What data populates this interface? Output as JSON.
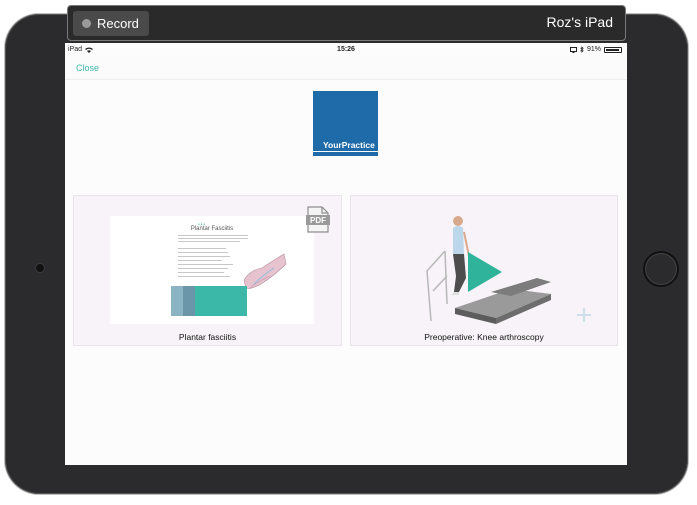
{
  "recorder": {
    "record_label": "Record",
    "device_name": "Roz's iPad"
  },
  "status_bar": {
    "device": "iPad",
    "time": "15:26",
    "battery": "91%"
  },
  "nav": {
    "close_label": "Close"
  },
  "logo": {
    "text": "YourPractice",
    "color": "#1f6aa8"
  },
  "cards": [
    {
      "title": "Plantar fasciitis",
      "type_badge": "PDF",
      "kind": "document"
    },
    {
      "title": "Preoperative: Knee arthroscopy",
      "kind": "video"
    }
  ],
  "document_preview": {
    "title": "Plantar Fasciitis"
  },
  "colors": {
    "accent": "#3fb6a9",
    "frame": "#2b2b2d",
    "play": "#2fb39a"
  }
}
